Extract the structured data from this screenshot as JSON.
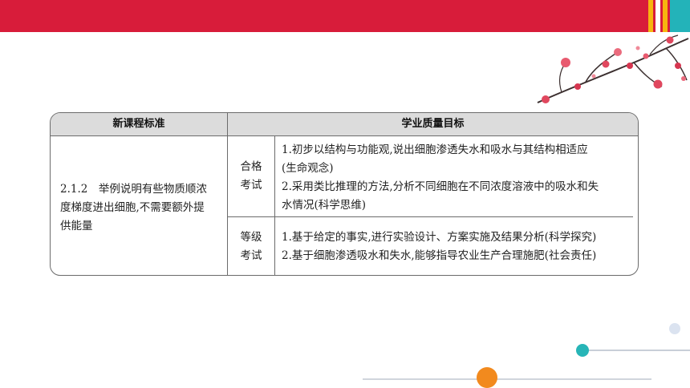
{
  "table": {
    "headers": {
      "standard": "新课程标准",
      "goals": "学业质量目标"
    },
    "standard": {
      "lines": [
        "2.1.2　举例说明有些物质顺浓",
        "度梯度进出细胞,不需要额外提",
        "供能量"
      ]
    },
    "levels": [
      {
        "label_lines": [
          "合格",
          "考试"
        ],
        "goal_lines": [
          "1.初步以结构与功能观,说出细胞渗透失水和吸水与其结构相适应",
          "(生命观念)",
          "2.采用类比推理的方法,分析不同细胞在不同浓度溶液中的吸水和失",
          "水情况(科学思维)"
        ]
      },
      {
        "label_lines": [
          "等级",
          "考试"
        ],
        "goal_lines": [
          "1.基于给定的事实,进行实验设计、方案实施及结果分析(科学探究)",
          "2.基于细胞渗透吸水和失水,能够指导农业生产合理施肥(社会责任)"
        ]
      }
    ]
  },
  "colors": {
    "top_bar": "#d81c3a",
    "accent_yellow": "#f7b50f",
    "accent_teal": "#23b3b9",
    "dot_orange": "#f28a1e",
    "header_fill": "#dcdcdc"
  }
}
